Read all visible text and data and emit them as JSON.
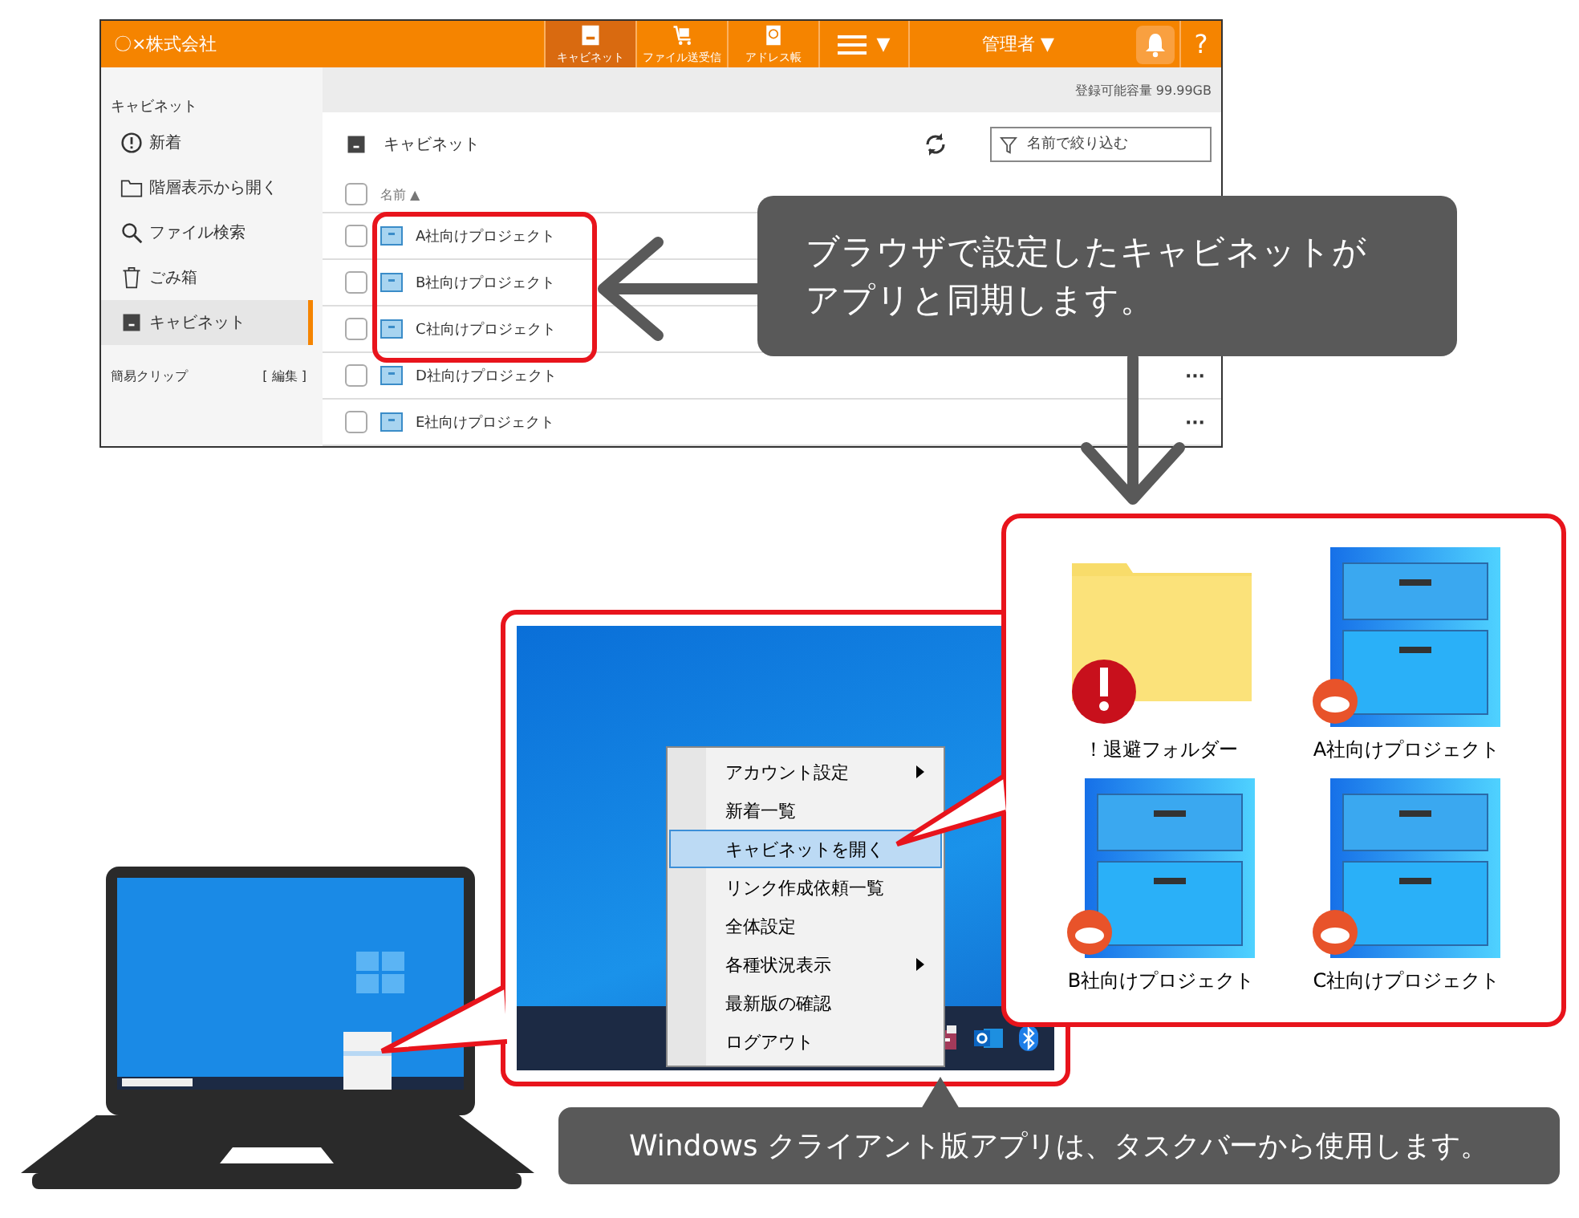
{
  "web_app": {
    "logo": "〇×株式会社",
    "nav": [
      {
        "label": "キャビネット",
        "kind": "cabinet",
        "selected": true
      },
      {
        "label": "ファイル送受信",
        "kind": "transfer",
        "selected": false
      },
      {
        "label": "アドレス帳",
        "kind": "address",
        "selected": false
      }
    ],
    "menu_caret": "▼",
    "user": "管理者 ▼",
    "help": "?",
    "sidebar": {
      "heading": "キャビネット",
      "items": [
        {
          "label": "新着",
          "kind": "new",
          "selected": false
        },
        {
          "label": "階層表示から開く",
          "kind": "tree",
          "selected": false
        },
        {
          "label": "ファイル検索",
          "kind": "search",
          "selected": false
        },
        {
          "label": "ごみ箱",
          "kind": "trash",
          "selected": false
        },
        {
          "label": "キャビネット",
          "kind": "cabinet",
          "selected": true
        }
      ],
      "clip_label": "簡易クリップ",
      "clip_edit": "[ 編集 ]"
    },
    "capacity": "登録可能容量 99.99GB",
    "title": "キャビネット",
    "filter_placeholder": "名前で絞り込む",
    "column": "名前 ▲",
    "select_all_checked": false,
    "rows": [
      {
        "name": "A社向けプロジェクト",
        "checked": false
      },
      {
        "name": "B社向けプロジェクト",
        "checked": false
      },
      {
        "name": "C社向けプロジェクト",
        "checked": false
      },
      {
        "name": "D社向けプロジェクト",
        "checked": false,
        "more": "···"
      },
      {
        "name": "E社向けプロジェクト",
        "checked": false,
        "more": "···"
      }
    ]
  },
  "callout_top": [
    "ブラウザで設定したキャビネットが",
    "アプリと同期します。"
  ],
  "context_menu": [
    {
      "label": "アカウント設定",
      "submenu": true,
      "selected": false
    },
    {
      "label": "新着一覧",
      "submenu": false,
      "selected": false
    },
    {
      "label": "キャビネットを開く",
      "submenu": false,
      "selected": true
    },
    {
      "label": "リンク作成依頼一覧",
      "submenu": false,
      "selected": false
    },
    {
      "label": "全体設定",
      "submenu": false,
      "selected": false
    },
    {
      "label": "各種状況表示",
      "submenu": true,
      "selected": false
    },
    {
      "label": "最新版の確認",
      "submenu": false,
      "selected": false
    },
    {
      "label": "ログアウト",
      "submenu": false,
      "selected": false
    }
  ],
  "folders": [
    {
      "label": "！退避フォルダー",
      "kind": "warning-folder"
    },
    {
      "label": "A社向けプロジェクト",
      "kind": "cabinet"
    },
    {
      "label": "B社向けプロジェクト",
      "kind": "cabinet"
    },
    {
      "label": "C社向けプロジェクト",
      "kind": "cabinet"
    }
  ],
  "callout_bottom": "Windows クライアント版アプリは、タスクバーから使用します。"
}
